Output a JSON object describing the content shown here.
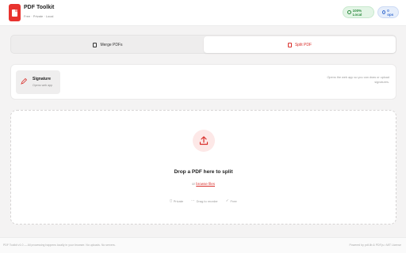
{
  "header": {
    "title": "PDF Toolkit",
    "subtitle": "Free · Private · Local",
    "badge_local": "100% Local",
    "badge_ops": "0 ops"
  },
  "tabs": [
    {
      "label": "Merge PDFs",
      "icon": "merge-icon",
      "active": false
    },
    {
      "label": "Split PDF",
      "icon": "split-icon",
      "active": true
    }
  ],
  "tool": {
    "label": "Signature",
    "hint": "Opens web app",
    "icon": "pen-icon",
    "description": "Opens the web app so you can draw or upload signatures."
  },
  "dropzone": {
    "title": "Drop a PDF here to split",
    "or_text": "or",
    "browse_label": "browse files",
    "features": [
      {
        "icon": "lock-icon",
        "label": "Private"
      },
      {
        "icon": "drag-icon",
        "label": "Drag to reorder"
      },
      {
        "icon": "check-icon",
        "label": "Free"
      }
    ]
  },
  "footer": {
    "left": "PDF Toolkit v1.0 — All processing happens locally in your browser. No uploads. No servers.",
    "right": "Powered by pdf-lib & PDF.js • MIT License"
  },
  "colors": {
    "accent": "#d9302c",
    "logo": "#e8332f",
    "local_badge": "#2e8b3f",
    "ops_badge": "#3b6fd0"
  }
}
